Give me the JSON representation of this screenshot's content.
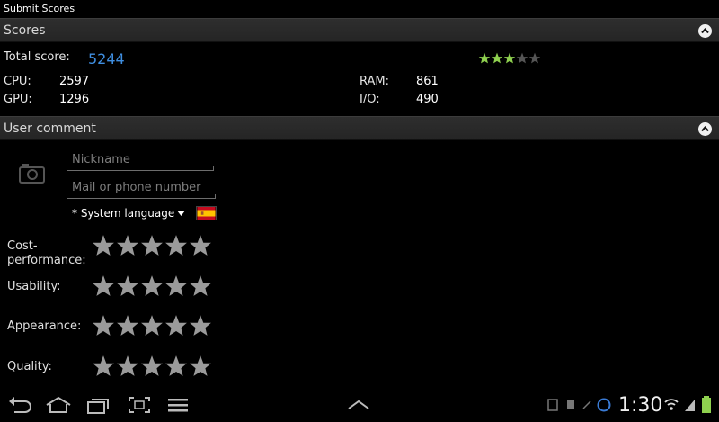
{
  "window": {
    "title": "Submit Scores"
  },
  "scores": {
    "header": "Scores",
    "total_label": "Total score:",
    "total_value": "5244",
    "star_rating": 3,
    "star_max": 5,
    "cpu_label": "CPU:",
    "cpu_value": "2597",
    "gpu_label": "GPU:",
    "gpu_value": "1296",
    "ram_label": "RAM:",
    "ram_value": "861",
    "io_label": "I/O:",
    "io_value": "490"
  },
  "comment": {
    "header": "User comment",
    "nickname_placeholder": "Nickname",
    "contact_placeholder": "Mail or phone number",
    "language": "* System language",
    "ratings": [
      {
        "label": "Cost-performance:",
        "line1": "Cost-",
        "line2": "performance:"
      },
      {
        "label": "Usability:"
      },
      {
        "label": "Appearance:"
      },
      {
        "label": "Quality:"
      }
    ]
  },
  "status": {
    "clock": "1:30"
  },
  "colors": {
    "accent": "#3f8ee0",
    "star_fill": "#9a9a9a",
    "mini_star_on": "#8fd14f",
    "mini_star_off": "#555555"
  },
  "icons": [
    "back-icon",
    "home-icon",
    "recent-apps-icon",
    "screenshot-icon",
    "menu-icon",
    "chevron-up-icon",
    "camera-icon",
    "wifi-icon",
    "signal-icon",
    "battery-icon"
  ]
}
